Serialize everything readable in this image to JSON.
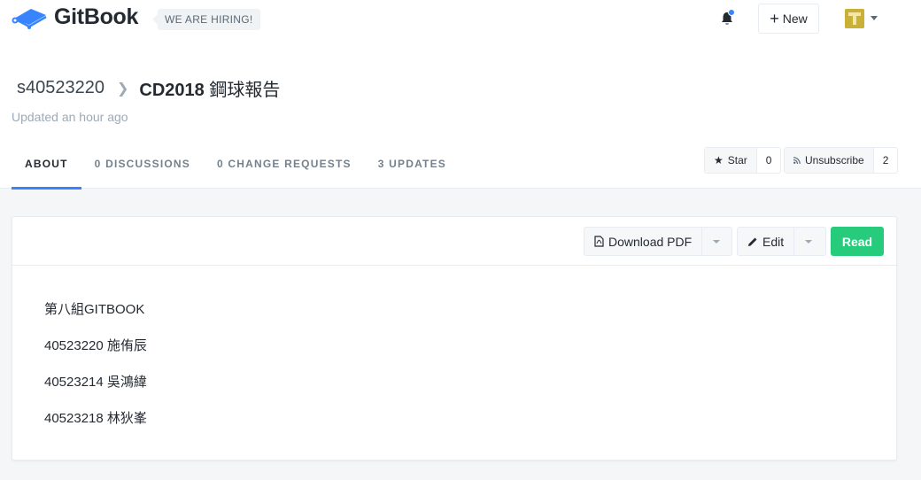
{
  "header": {
    "brand": "GitBook",
    "hiring_badge": "WE ARE HIRING!",
    "new_label": "New",
    "colors": {
      "accent": "#3884ff",
      "brand_dark": "#242a31",
      "read_green": "#26cb7c"
    }
  },
  "breadcrumb": {
    "owner": "s40523220",
    "space_code": "CD2018",
    "space_name": "鋼球報告"
  },
  "updated_text": "Updated an hour ago",
  "tabs": [
    {
      "label": "ABOUT",
      "active": true
    },
    {
      "label": "0 DISCUSSIONS",
      "active": false
    },
    {
      "label": "0 CHANGE REQUESTS",
      "active": false
    },
    {
      "label": "3 UPDATES",
      "active": false
    }
  ],
  "social": {
    "star_label": "Star",
    "star_count": "0",
    "unsubscribe_label": "Unsubscribe",
    "subscriber_count": "2"
  },
  "card": {
    "download_pdf_label": "Download PDF",
    "edit_label": "Edit",
    "read_label": "Read",
    "content": [
      "第八組GITBOOK",
      "40523220 施侑辰",
      "40523214 吳鴻緯",
      "40523218 林狄峯"
    ]
  }
}
